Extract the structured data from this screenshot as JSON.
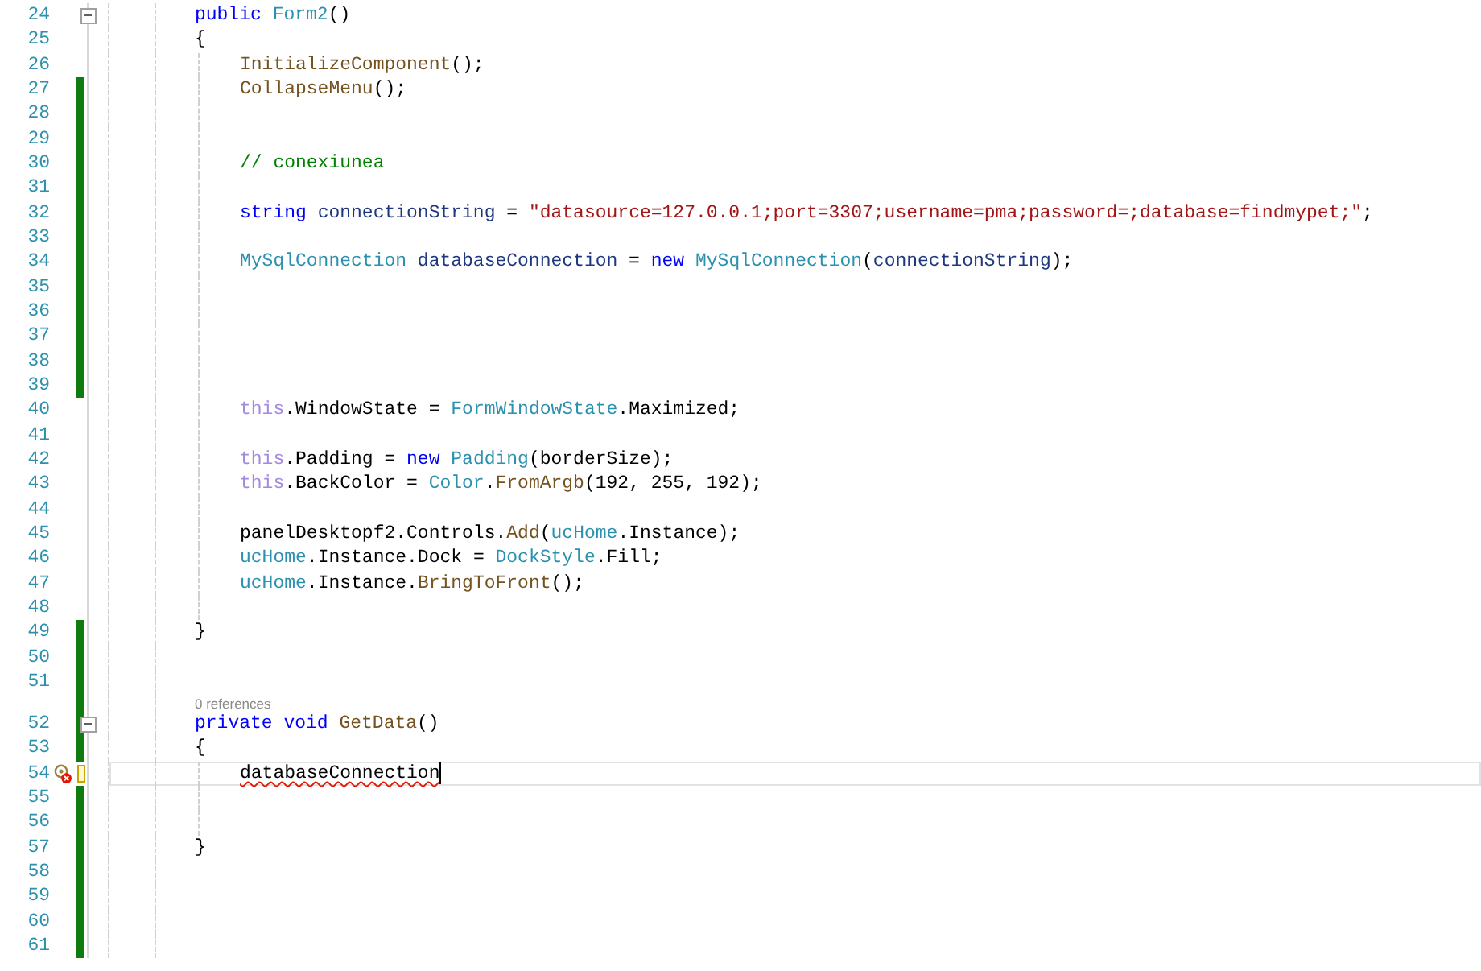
{
  "editor": {
    "lines": [
      {
        "number": "24",
        "kind": "member",
        "fold": true,
        "tokens": [
          {
            "kind": "kw",
            "text": "public "
          },
          {
            "kind": "type",
            "text": "Form2"
          },
          {
            "kind": "plain",
            "text": "()"
          }
        ]
      },
      {
        "number": "25",
        "kind": "member",
        "tokens": [
          {
            "kind": "plain",
            "text": "{"
          }
        ]
      },
      {
        "number": "26",
        "kind": "body",
        "tokens": [
          {
            "kind": "method",
            "text": "InitializeComponent"
          },
          {
            "kind": "plain",
            "text": "();"
          }
        ]
      },
      {
        "number": "27",
        "kind": "body",
        "modified": true,
        "tokens": [
          {
            "kind": "method",
            "text": "CollapseMenu"
          },
          {
            "kind": "plain",
            "text": "();"
          }
        ]
      },
      {
        "number": "28",
        "kind": "body",
        "modified": true
      },
      {
        "number": "29",
        "kind": "body",
        "modified": true
      },
      {
        "number": "30",
        "kind": "body",
        "modified": true,
        "tokens": [
          {
            "kind": "comment",
            "text": "// conexiunea"
          }
        ]
      },
      {
        "number": "31",
        "kind": "body",
        "modified": true
      },
      {
        "number": "32",
        "kind": "body",
        "modified": true,
        "tokens": [
          {
            "kind": "kw",
            "text": "string "
          },
          {
            "kind": "local",
            "text": "connectionString"
          },
          {
            "kind": "plain",
            "text": " = "
          },
          {
            "kind": "string",
            "text": "\"datasource=127.0.0.1;port=3307;username=pma;password=;database=findmypet;\""
          },
          {
            "kind": "plain",
            "text": ";"
          }
        ]
      },
      {
        "number": "33",
        "kind": "body",
        "modified": true
      },
      {
        "number": "34",
        "kind": "body",
        "modified": true,
        "tokens": [
          {
            "kind": "type",
            "text": "MySqlConnection "
          },
          {
            "kind": "local",
            "text": "databaseConnection"
          },
          {
            "kind": "plain",
            "text": " = "
          },
          {
            "kind": "kw",
            "text": "new "
          },
          {
            "kind": "type",
            "text": "MySqlConnection"
          },
          {
            "kind": "plain",
            "text": "("
          },
          {
            "kind": "local",
            "text": "connectionString"
          },
          {
            "kind": "plain",
            "text": ");"
          }
        ]
      },
      {
        "number": "35",
        "kind": "body",
        "modified": true
      },
      {
        "number": "36",
        "kind": "body",
        "modified": true
      },
      {
        "number": "37",
        "kind": "body",
        "modified": true
      },
      {
        "number": "38",
        "kind": "body",
        "modified": true
      },
      {
        "number": "39",
        "kind": "body",
        "modified": true
      },
      {
        "number": "40",
        "kind": "body",
        "tokens": [
          {
            "kind": "faded",
            "text": "this"
          },
          {
            "kind": "plain",
            "text": ".WindowState = "
          },
          {
            "kind": "type",
            "text": "FormWindowState"
          },
          {
            "kind": "plain",
            "text": ".Maximized;"
          }
        ]
      },
      {
        "number": "41",
        "kind": "body"
      },
      {
        "number": "42",
        "kind": "body",
        "tokens": [
          {
            "kind": "faded",
            "text": "this"
          },
          {
            "kind": "plain",
            "text": ".Padding = "
          },
          {
            "kind": "kw",
            "text": "new "
          },
          {
            "kind": "type",
            "text": "Padding"
          },
          {
            "kind": "plain",
            "text": "(borderSize);"
          }
        ]
      },
      {
        "number": "43",
        "kind": "body",
        "tokens": [
          {
            "kind": "faded",
            "text": "this"
          },
          {
            "kind": "plain",
            "text": ".BackColor = "
          },
          {
            "kind": "type",
            "text": "Color"
          },
          {
            "kind": "plain",
            "text": "."
          },
          {
            "kind": "method",
            "text": "FromArgb"
          },
          {
            "kind": "plain",
            "text": "(192, 255, 192);"
          }
        ]
      },
      {
        "number": "44",
        "kind": "body"
      },
      {
        "number": "45",
        "kind": "body",
        "tokens": [
          {
            "kind": "plain",
            "text": "panelDesktopf2.Controls."
          },
          {
            "kind": "method",
            "text": "Add"
          },
          {
            "kind": "plain",
            "text": "("
          },
          {
            "kind": "type",
            "text": "ucHome"
          },
          {
            "kind": "plain",
            "text": ".Instance);"
          }
        ]
      },
      {
        "number": "46",
        "kind": "body",
        "tokens": [
          {
            "kind": "type",
            "text": "ucHome"
          },
          {
            "kind": "plain",
            "text": ".Instance.Dock = "
          },
          {
            "kind": "type",
            "text": "DockStyle"
          },
          {
            "kind": "plain",
            "text": ".Fill;"
          }
        ]
      },
      {
        "number": "47",
        "kind": "body",
        "tokens": [
          {
            "kind": "type",
            "text": "ucHome"
          },
          {
            "kind": "plain",
            "text": ".Instance."
          },
          {
            "kind": "method",
            "text": "BringToFront"
          },
          {
            "kind": "plain",
            "text": "();"
          }
        ]
      },
      {
        "number": "48",
        "kind": "body"
      },
      {
        "number": "49",
        "kind": "member",
        "modified": true,
        "tokens": [
          {
            "kind": "plain",
            "text": "}"
          }
        ]
      },
      {
        "number": "50",
        "kind": "blank",
        "modified": true
      },
      {
        "number": "51",
        "kind": "blank",
        "modified": true
      },
      {
        "number": "52",
        "kind": "member",
        "modified": true,
        "fold": true,
        "references": "0 references",
        "tokens": [
          {
            "kind": "kw",
            "text": "private void "
          },
          {
            "kind": "method",
            "text": "GetData"
          },
          {
            "kind": "plain",
            "text": "()"
          }
        ]
      },
      {
        "number": "53",
        "kind": "member",
        "modified": true,
        "tokens": [
          {
            "kind": "plain",
            "text": "{"
          }
        ]
      },
      {
        "number": "54",
        "kind": "body",
        "unsaved": true,
        "current": true,
        "error": true,
        "cursor": true,
        "tokens": [
          {
            "kind": "error",
            "text": "databaseConnection"
          }
        ]
      },
      {
        "number": "55",
        "kind": "body",
        "modified": true
      },
      {
        "number": "56",
        "kind": "body",
        "modified": true
      },
      {
        "number": "57",
        "kind": "member",
        "modified": true,
        "tokens": [
          {
            "kind": "plain",
            "text": "}"
          }
        ]
      },
      {
        "number": "58",
        "kind": "blank",
        "modified": true
      },
      {
        "number": "59",
        "kind": "blank",
        "modified": true
      },
      {
        "number": "60",
        "kind": "blank",
        "modified": true
      },
      {
        "number": "61",
        "kind": "blank",
        "modified": true
      }
    ]
  }
}
